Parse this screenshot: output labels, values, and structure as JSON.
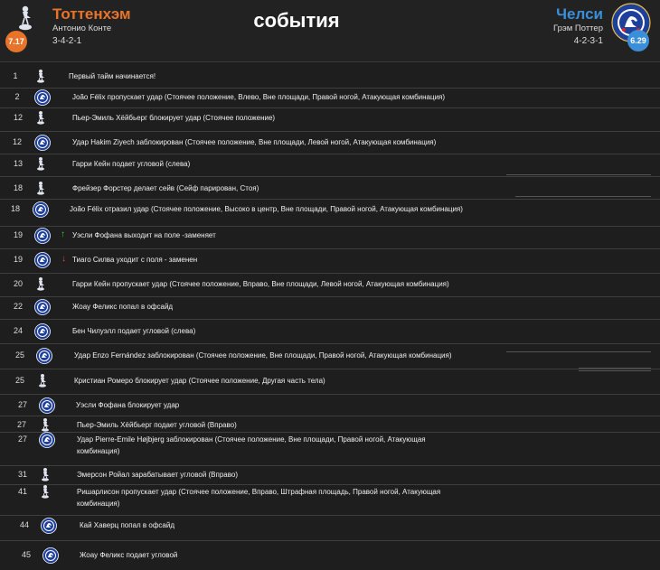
{
  "header": {
    "title": "события",
    "home": {
      "name": "Тоттенхэм",
      "coach": "Антонио Конте",
      "formation": "3-4-2-1",
      "rating": "7.17",
      "logo_icon": "tottenham-cockerel-icon",
      "color": "#e8742a"
    },
    "away": {
      "name": "Челси",
      "coach": "Грэм Поттер",
      "formation": "4-2-3-1",
      "rating": "6.29",
      "logo_icon": "chelsea-lion-crest-icon",
      "color": "#3a8fd8"
    }
  },
  "events": [
    {
      "minute": "1",
      "team": "spurs",
      "text": "Первый тайм начинается!"
    },
    {
      "minute": "2",
      "team": "chelsea",
      "text": "João Félix пропускает удар (Стоячее положение, Влево, Вне площади, Правой ногой, Атакующая комбинация)"
    },
    {
      "minute": "12",
      "team": "spurs",
      "text": "Пьер-Эмиль Хёйбьерг блокирует удар (Стоячее положение)"
    },
    {
      "minute": "12",
      "team": "chelsea",
      "text": "Удар Hakim Ziyech заблокирован (Стоячее положение, Вне площади, Левой ногой, Атакующая комбинация)"
    },
    {
      "minute": "13",
      "team": "spurs",
      "text": "Гарри Кейн подает угловой (слева)"
    },
    {
      "minute": "18",
      "team": "spurs",
      "text": "Фрейзер Форстер делает сейв (Сейф парирован, Стоя)"
    },
    {
      "minute": "18",
      "team": "chelsea",
      "text": "João Félix отразил удар (Стоячее положение, Высоко в центр, Вне площади, Правой ногой, Атакующая комбинация)"
    },
    {
      "minute": "19",
      "team": "chelsea",
      "arrow": "↑",
      "arrow_type": "up",
      "text": "Уэсли Фофана выходит на поле -заменяет"
    },
    {
      "minute": "19",
      "team": "chelsea",
      "arrow": "↓",
      "arrow_type": "down",
      "text": "Тиаго Силва уходит с поля - заменен"
    },
    {
      "minute": "20",
      "team": "spurs",
      "text": "Гарри Кейн пропускает удар (Стоячее положение, Вправо, Вне площади, Левой ногой, Атакующая комбинация)"
    },
    {
      "minute": "22",
      "team": "chelsea",
      "text": "Жоау Феликс попал в офсайд"
    },
    {
      "minute": "24",
      "team": "chelsea",
      "text": "Бен Чилуэлл подает угловой (слева)"
    },
    {
      "minute": "25",
      "team": "chelsea",
      "text": "Удар Enzo Fernández заблокирован (Стоячее положение, Вне площади, Правой ногой, Атакующая комбинация)"
    },
    {
      "minute": "25",
      "team": "spurs",
      "text": "Кристиан Ромеро блокирует удар (Стоячее положение, Другая часть тела)"
    },
    {
      "minute": "27",
      "team": "chelsea",
      "text": "Уэсли Фофана блокирует удар"
    },
    {
      "minute": "27",
      "team": "spurs",
      "text": "Пьер-Эмиль Хёйбьерг подает угловой (Вправо)"
    },
    {
      "minute": "27",
      "team": "chelsea",
      "text": "Удар Pierre-Emile Højbjerg заблокирован (Стоячее положение, Вне площади, Правой ногой, Атакующая комбинация)"
    },
    {
      "minute": "31",
      "team": "spurs",
      "text": "Эмерсон Ройал зарабатывает угловой (Вправо)"
    },
    {
      "minute": "41",
      "team": "spurs",
      "text": "Ришарлисон пропускает удар (Стоячее положение, Вправо, Штрафная площадь, Правой ногой, Атакующая комбинация)"
    },
    {
      "minute": "44",
      "team": "chelsea",
      "text": "Кай Хаверц попал в офсайд"
    },
    {
      "minute": "45",
      "team": "chelsea",
      "text": "Жоау Феликс подает угловой"
    }
  ],
  "icons": {
    "spurs": "tottenham-cockerel-icon",
    "chelsea": "chelsea-lion-crest-icon"
  }
}
